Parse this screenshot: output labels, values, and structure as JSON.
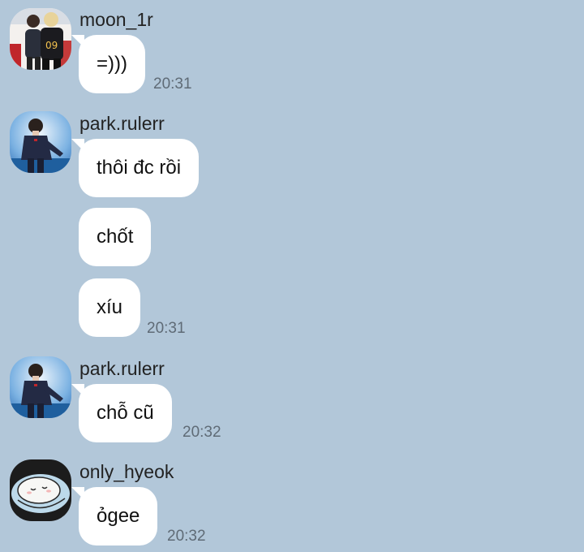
{
  "theme": {
    "background": "#b2c7d9",
    "bubble": "#ffffff",
    "timestamp_color": "#5f6b76"
  },
  "message_groups": [
    {
      "sender": "moon_1r",
      "avatar_icon": "profile-photo-two-people-jersey-09",
      "messages": [
        "=)))"
      ],
      "time": "20:31"
    },
    {
      "sender": "park.rulerr",
      "avatar_icon": "profile-photo-person-dark-jacket",
      "messages": [
        "thôi đc rồi",
        "chốt",
        "xíu"
      ],
      "time": "20:31"
    },
    {
      "sender": "park.rulerr",
      "avatar_icon": "profile-photo-person-dark-jacket",
      "messages": [
        "chỗ cũ"
      ],
      "time": "20:32"
    },
    {
      "sender": "only_hyeok",
      "avatar_icon": "profile-cartoon-sleeping-creature",
      "messages": [
        "ỏgee"
      ],
      "time": "20:32"
    }
  ]
}
